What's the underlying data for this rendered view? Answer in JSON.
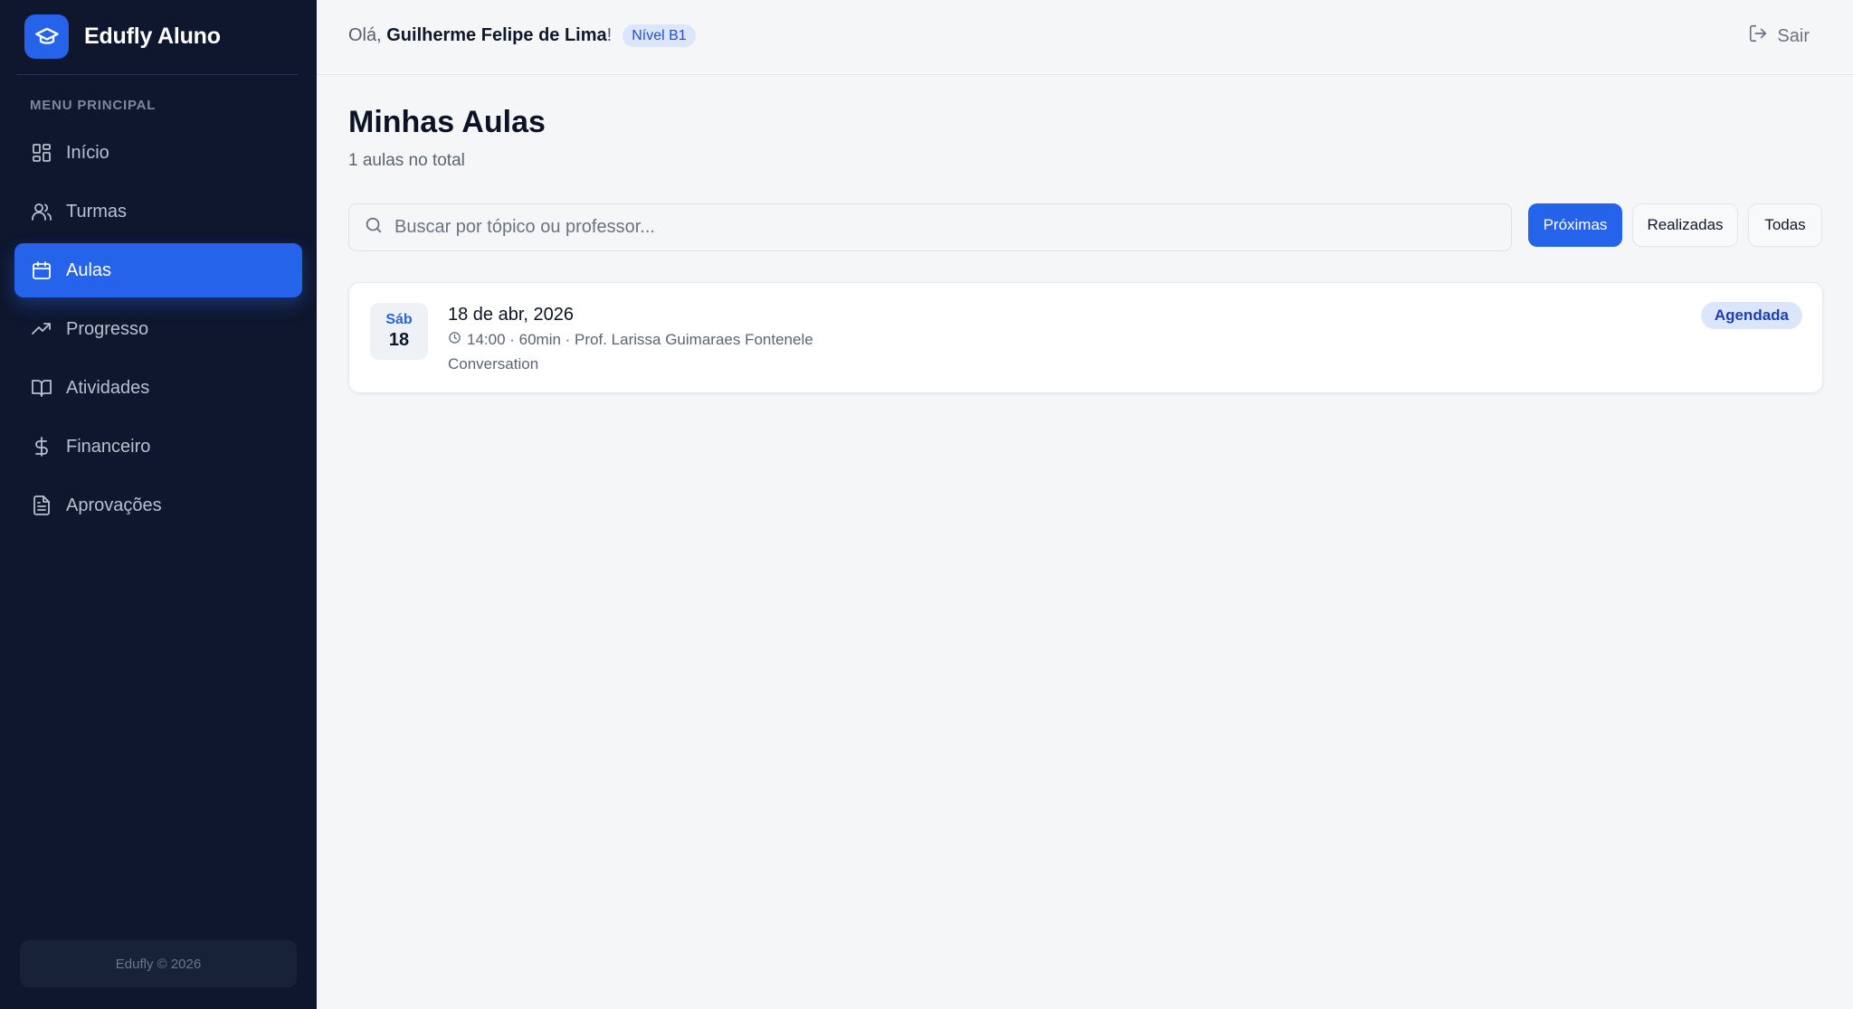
{
  "app": {
    "name": "Edufly Aluno",
    "logo_icon": "graduation-cap-icon"
  },
  "sidebar": {
    "section_label": "MENU PRINCIPAL",
    "items": [
      {
        "label": "Início",
        "icon": "dashboard-icon",
        "active": false
      },
      {
        "label": "Turmas",
        "icon": "users-icon",
        "active": false
      },
      {
        "label": "Aulas",
        "icon": "calendar-icon",
        "active": true
      },
      {
        "label": "Progresso",
        "icon": "trending-up-icon",
        "active": false
      },
      {
        "label": "Atividades",
        "icon": "book-open-icon",
        "active": false
      },
      {
        "label": "Financeiro",
        "icon": "dollar-icon",
        "active": false
      },
      {
        "label": "Aprovações",
        "icon": "file-text-icon",
        "active": false
      }
    ],
    "footer": "Edufly © 2026"
  },
  "header": {
    "greeting_prefix": "Olá,",
    "user_name": "Guilherme Felipe de Lima",
    "greeting_suffix": "!",
    "level_badge": "Nível B1",
    "logout_label": "Sair"
  },
  "main": {
    "title": "Minhas Aulas",
    "subtitle": "1 aulas no total",
    "search_placeholder": "Buscar por tópico ou professor...",
    "search_value": "",
    "filters": [
      {
        "label": "Próximas",
        "active": true
      },
      {
        "label": "Realizadas",
        "active": false
      },
      {
        "label": "Todas",
        "active": false
      }
    ],
    "lessons": [
      {
        "day_of_week": "Sáb",
        "day": "18",
        "date": "18 de abr, 2026",
        "meta": "14:00 · 60min · Prof. Larissa Guimaraes Fontenele",
        "topic": "Conversation",
        "status": "Agendada"
      }
    ]
  },
  "colors": {
    "accent": "#2563eb",
    "sidebar_bg": "#0f172e",
    "page_bg": "#f5f6f8",
    "badge_bg": "#dbe6fd"
  }
}
